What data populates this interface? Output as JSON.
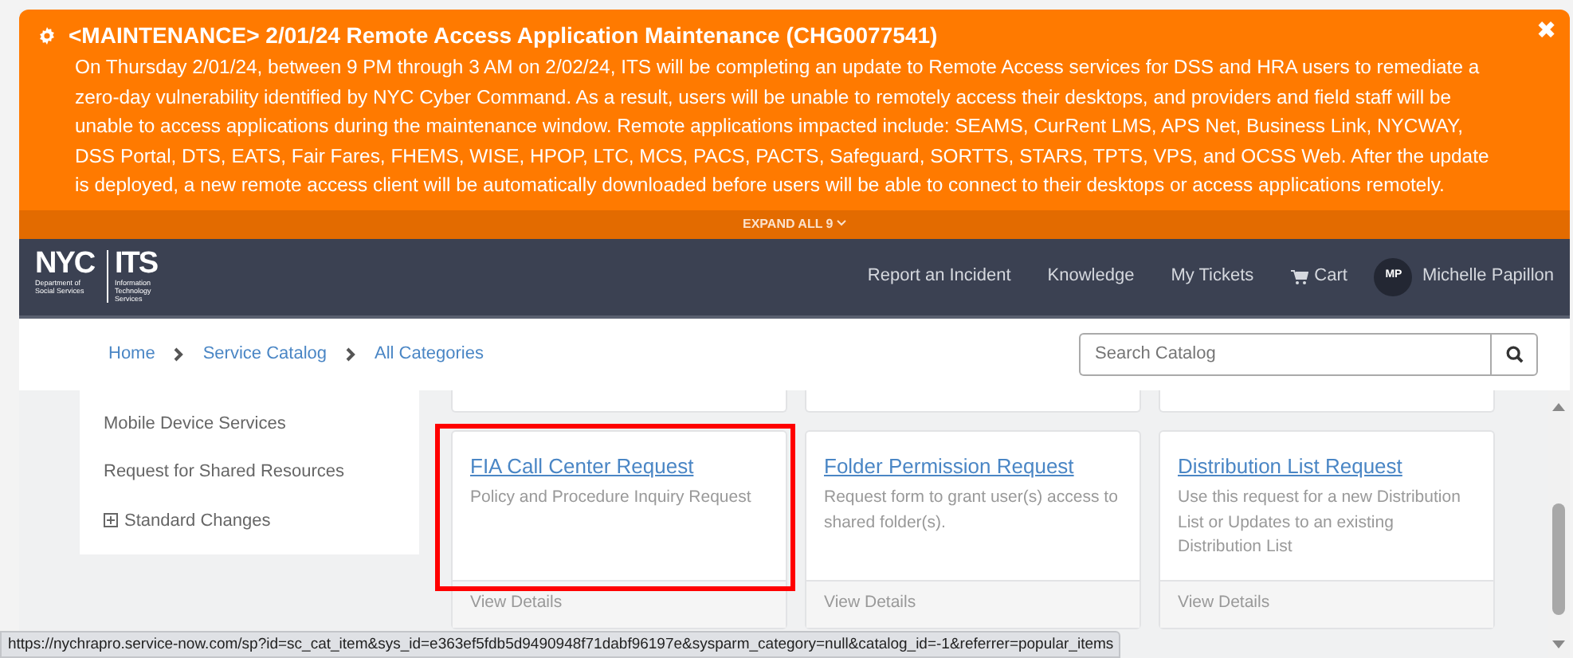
{
  "banner": {
    "title": "<MAINTENANCE> 2/01/24 Remote Access Application Maintenance (CHG0077541)",
    "body": "On Thursday 2/01/24, between 9 PM through 3 AM on 2/02/24, ITS will be completing an update to Remote Access services for DSS and HRA users to remediate a zero-day vulnerability identified by NYC Cyber Command. As a result, users will be unable to remotely access their desktops, and providers and field staff will be unable to access applications during the maintenance window. Remote applications impacted include: SEAMS, CurRent LMS, APS Net, Business Link, NYCWAY, DSS Portal, DTS, EATS, Fair Fares, FHEMS, WISE, HPOP, LTC, MCS, PACS, PACTS, Safeguard, SORTTS, STARS, TPTS, VPS, and OCSS Web. After the update is deployed, a new remote access client will be automatically downloaded before users will be able to connect to their desktops or access applications remotely.",
    "close": "✖",
    "expand": "EXPAND ALL 9"
  },
  "navbar": {
    "logo": {
      "left": "NYC",
      "left_sub": "Department of Social Services",
      "right": "ITS",
      "right_sub": "Information Technology Services"
    },
    "links": [
      {
        "label": "Report an Incident",
        "kind": "text"
      },
      {
        "label": "Knowledge",
        "kind": "text"
      },
      {
        "label": "My Tickets",
        "kind": "text"
      },
      {
        "label": "Cart",
        "kind": "cart"
      }
    ],
    "user": {
      "initials": "MP",
      "name": "Michelle Papillon"
    }
  },
  "breadcrumb": [
    "Home",
    "Service Catalog",
    "All Categories"
  ],
  "search": {
    "placeholder": "Search Catalog"
  },
  "sidebar": {
    "items": [
      {
        "label": "Mobile Device Services",
        "kind": "plain"
      },
      {
        "label": "Request for Shared Resources",
        "kind": "plain"
      },
      {
        "label": "Standard Changes",
        "kind": "expandable"
      }
    ]
  },
  "cards": [
    {
      "title": "FIA Call Center Request",
      "description": "Policy and Procedure Inquiry Request",
      "footer": "View Details",
      "highlighted": true
    },
    {
      "title": "Folder Permission Request",
      "description": "Request form to grant user(s) access to shared folder(s).",
      "footer": "View Details",
      "highlighted": false
    },
    {
      "title": "Distribution List Request",
      "description": "Use this request for a new Distribution List or Updates to an existing Distribution List",
      "footer": "View Details",
      "highlighted": false
    }
  ],
  "status_bar": {
    "url": "https://nychrapro.service-now.com/sp?id=sc_cat_item&sys_id=e363ef5fdb5d9490948f71dabf96197e&sysparm_category=null&catalog_id=-1&referrer=popular_items"
  }
}
